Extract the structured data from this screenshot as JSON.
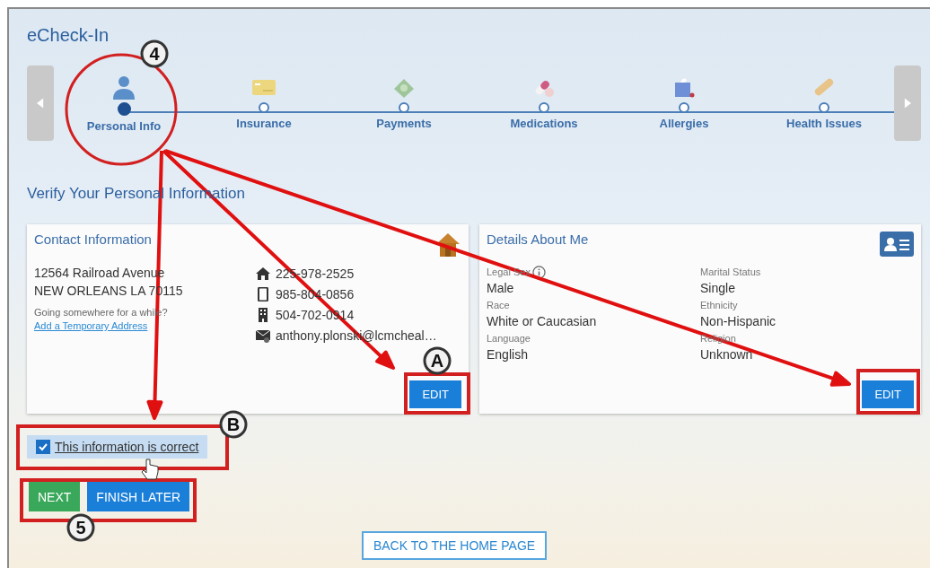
{
  "page": {
    "title": "eCheck-In"
  },
  "stepper": {
    "steps": [
      {
        "label": "Personal Info",
        "selected": true,
        "kind": "person"
      },
      {
        "label": "Insurance",
        "selected": false,
        "kind": "card"
      },
      {
        "label": "Payments",
        "selected": false,
        "kind": "money"
      },
      {
        "label": "Medications",
        "selected": false,
        "kind": "pill"
      },
      {
        "label": "Allergies",
        "selected": false,
        "kind": "tissue"
      },
      {
        "label": "Health Issues",
        "selected": false,
        "kind": "bandage"
      }
    ]
  },
  "heading": "Verify Your Personal Information",
  "contact": {
    "title": "Contact Information",
    "address": [
      "12564 Railroad Avenue",
      "NEW ORLEANS LA 70115"
    ],
    "hint": "Going somewhere for a while?",
    "link": "Add a Temporary Address",
    "phones": [
      {
        "kind": "home",
        "text": "225-978-2525"
      },
      {
        "kind": "mobile",
        "text": "985-804-0856"
      },
      {
        "kind": "work",
        "text": "504-702-0914"
      },
      {
        "kind": "email",
        "text": "anthony.plonski@lcmcheal…"
      }
    ],
    "edit": "EDIT"
  },
  "details": {
    "title": "Details About Me",
    "fields": [
      {
        "label": "Legal Sex",
        "value": "Male",
        "info": true
      },
      {
        "label": "Marital Status",
        "value": "Single",
        "info": false
      },
      {
        "label": "Race",
        "value": "White or Caucasian",
        "info": false
      },
      {
        "label": "Ethnicity",
        "value": "Non-Hispanic",
        "info": false
      },
      {
        "label": "Language",
        "value": "English",
        "info": false
      },
      {
        "label": "Religion",
        "value": "Unknown",
        "info": false
      }
    ],
    "edit": "EDIT"
  },
  "confirm": {
    "label": "This information is correct",
    "checked": true
  },
  "buttons": [
    {
      "label": "NEXT",
      "kind": "next"
    },
    {
      "label": "FINISH LATER",
      "kind": "later"
    }
  ],
  "home_link": "BACK TO THE HOME PAGE",
  "annotations": [
    {
      "label": "4"
    },
    {
      "label": "A"
    },
    {
      "label": "B"
    },
    {
      "label": "5"
    }
  ]
}
